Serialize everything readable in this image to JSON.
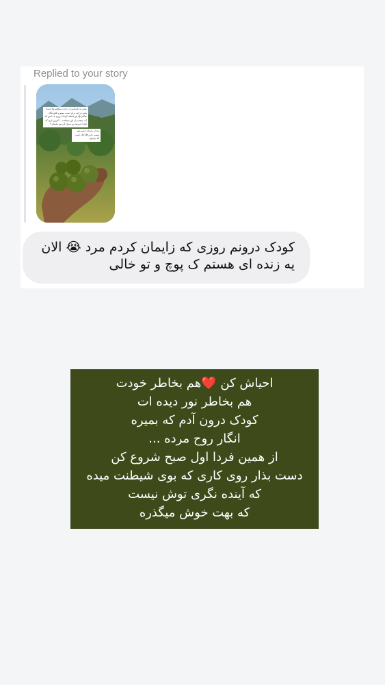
{
  "reply": {
    "label": "Replied to your story",
    "story_preview": {
      "text_main": "بچش یا ناشناس از درخت میگفتم ولا حسنا پایین درخت برام دست مونو و تلخو نگاه میکنم 😌 این لحظه کودک درونم با دانش که آب میشدم از این شیطنت... آخرین باری که کودک درونت رو دیدی کی بود ماسان ؟",
      "text_tail": "بعد از ماسان حسن هم نوشی دارم 😅 حال خوب که برامون"
    },
    "message": "کودک درونم روزی که زایمان کردم مرد 😭 الان یه زنده ای هستم ک پوچ و تو خالی"
  },
  "quote": {
    "lines": [
      "احیاش کن ❤️هم بخاطر خودت",
      "هم بخاطر نور دیده ات",
      "کودک درون آدم که بمیره",
      "انگار روح مرده ...",
      "از همین فردا اول صبح  شروع کن",
      "دست بذار روی کاری که بوی شیطنت میده",
      "که آینده نگری توش نیست",
      "که بهت خوش میگذره"
    ]
  },
  "colors": {
    "page_background": "#f4f5f7",
    "card_background": "#ffffff",
    "bubble_background": "#efeff2",
    "quote_background": "#3e4a1a",
    "quote_text": "#ffffff",
    "label_text": "#8e8e8e"
  }
}
